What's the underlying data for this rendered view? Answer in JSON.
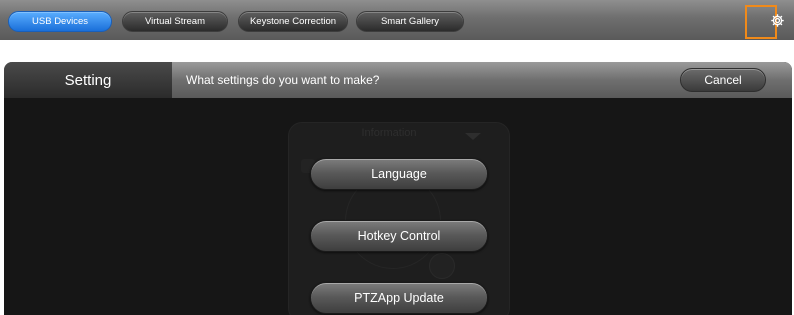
{
  "top_tabs": {
    "items": [
      {
        "label": "USB Devices",
        "active": true
      },
      {
        "label": "Virtual Stream",
        "active": false
      },
      {
        "label": "Keystone Correction",
        "active": false
      },
      {
        "label": "Smart Gallery",
        "active": false
      }
    ],
    "settings_icon": "gear-icon",
    "highlight_color": "#f08a1a"
  },
  "setting_panel": {
    "title": "Setting",
    "question": "What settings do you want to make?",
    "cancel_label": "Cancel"
  },
  "background_card": {
    "title": "Information"
  },
  "menu": {
    "items": [
      {
        "label": "Language"
      },
      {
        "label": "Hotkey Control"
      },
      {
        "label": "PTZApp Update"
      }
    ]
  },
  "colors": {
    "active_tab": "#2b87f0",
    "panel_background": "#161616"
  }
}
